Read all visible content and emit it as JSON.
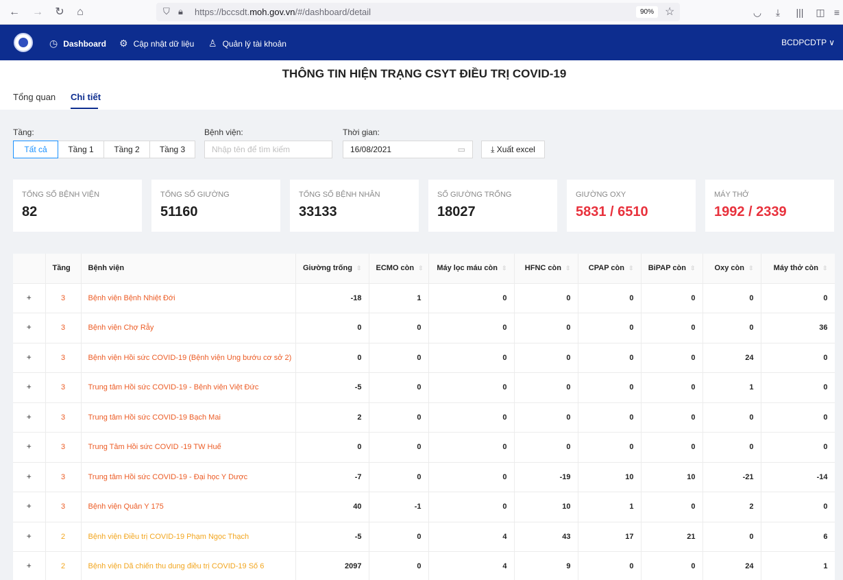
{
  "browser": {
    "url_prefix": "https://bccsdt.",
    "url_domain": "moh.gov.vn",
    "url_path": "/#/dashboard/detail",
    "zoom": "90%"
  },
  "header": {
    "menu": [
      {
        "label": "Dashboard",
        "icon": "dashboard-icon"
      },
      {
        "label": "Cập nhật dữ liệu",
        "icon": "settings-icon"
      },
      {
        "label": "Quản lý tài khoản",
        "icon": "user-icon"
      }
    ],
    "user": "BCDPCDTP ∨"
  },
  "page": {
    "title": "THÔNG TIN HIỆN TRẠNG CSYT ĐIỀU TRỊ COVID-19",
    "tabs": [
      "Tổng quan",
      "Chi tiết"
    ]
  },
  "filters": {
    "tier_label": "Tầng:",
    "tier_options": [
      "Tất cả",
      "Tầng 1",
      "Tầng 2",
      "Tầng 3"
    ],
    "hospital_label": "Bệnh viện:",
    "hospital_placeholder": "Nhập tên để tìm kiếm",
    "time_label": "Thời gian:",
    "date_value": "16/08/2021",
    "export_label": "⤓  Xuất excel"
  },
  "stats": [
    {
      "label": "TỔNG SỐ BỆNH VIỆN",
      "value": "82"
    },
    {
      "label": "TỔNG SỐ GIƯỜNG",
      "value": "51160"
    },
    {
      "label": "TỔNG SỐ BỆNH NHÂN",
      "value": "33133"
    },
    {
      "label": "SỐ GIƯỜNG TRỐNG",
      "value": "18027"
    },
    {
      "label": "GIƯỜNG OXY",
      "value": "5831 / 6510"
    },
    {
      "label": "MÁY THỞ",
      "value": "1992 / 2339"
    }
  ],
  "table": {
    "columns": [
      "",
      "Tầng",
      "Bệnh viện",
      "Giường trống",
      "ECMO còn",
      "Máy lọc máu còn",
      "HFNC còn",
      "CPAP còn",
      "BiPAP còn",
      "Oxy còn",
      "Máy thở còn"
    ],
    "rows": [
      {
        "tier": "3",
        "name": "Bệnh viện Bệnh Nhiệt Đới",
        "values": [
          "-18",
          "1",
          "0",
          "0",
          "0",
          "0",
          "0",
          "0"
        ]
      },
      {
        "tier": "3",
        "name": "Bệnh viện Chợ Rẫy",
        "values": [
          "0",
          "0",
          "0",
          "0",
          "0",
          "0",
          "0",
          "36"
        ]
      },
      {
        "tier": "3",
        "name": "Bệnh viện Hồi sức COVID-19 (Bệnh viện Ung bướu cơ sở 2)",
        "values": [
          "0",
          "0",
          "0",
          "0",
          "0",
          "0",
          "24",
          "0"
        ]
      },
      {
        "tier": "3",
        "name": "Trung tâm Hồi sức COVID-19 - Bệnh viện Việt Đức",
        "values": [
          "-5",
          "0",
          "0",
          "0",
          "0",
          "0",
          "1",
          "0"
        ]
      },
      {
        "tier": "3",
        "name": "Trung tâm Hồi sức COVID-19 Bạch Mai",
        "values": [
          "2",
          "0",
          "0",
          "0",
          "0",
          "0",
          "0",
          "0"
        ]
      },
      {
        "tier": "3",
        "name": "Trung Tâm Hồi sức COVID -19 TW Huế",
        "values": [
          "0",
          "0",
          "0",
          "0",
          "0",
          "0",
          "0",
          "0"
        ]
      },
      {
        "tier": "3",
        "name": "Trung tâm Hồi sức COVID-19 - Đại học Y Dược",
        "values": [
          "-7",
          "0",
          "0",
          "-19",
          "10",
          "10",
          "-21",
          "-14"
        ]
      },
      {
        "tier": "3",
        "name": "Bệnh viện Quân Y 175",
        "values": [
          "40",
          "-1",
          "0",
          "10",
          "1",
          "0",
          "2",
          "0"
        ]
      },
      {
        "tier": "2",
        "name": "Bệnh viện Điều trị COVID-19 Phạm Ngọc Thạch",
        "values": [
          "-5",
          "0",
          "4",
          "43",
          "17",
          "21",
          "0",
          "6"
        ]
      },
      {
        "tier": "2",
        "name": "Bệnh viện Dã chiến thu dung điều trị COVID-19 Số 6",
        "values": [
          "2097",
          "0",
          "4",
          "9",
          "0",
          "0",
          "24",
          "1"
        ]
      }
    ]
  },
  "colors": {
    "header_bg": "#0d2d8f",
    "tier3": "#ec5b24",
    "tier2": "#f2a51e",
    "stat_red": "#e8313c",
    "active_blue": "#1890ff"
  }
}
